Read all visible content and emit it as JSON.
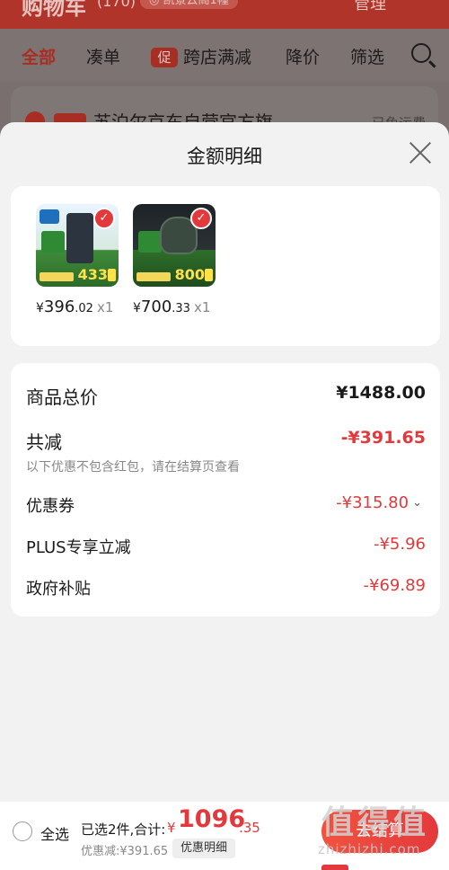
{
  "background": {
    "title": "购物车",
    "count": "(170)",
    "address": "凯景云阁1幢",
    "manage": "管理",
    "tabs": [
      {
        "label": "全部",
        "active": true
      },
      {
        "label": "凑单",
        "active": false
      },
      {
        "label": "跨店满减",
        "promo": "促",
        "active": false
      },
      {
        "label": "降价",
        "active": false
      },
      {
        "label": "筛选",
        "active": false
      }
    ],
    "store": {
      "tag": "自营",
      "name": "苏泊尔京东自营官方旗…",
      "shipping": "已免运费"
    }
  },
  "sheet": {
    "title": "金额明细",
    "products": [
      {
        "symbol": "¥",
        "int": "396",
        "dec": ".02",
        "qty": "x1",
        "thumb_price": "433",
        "icon": "water-dispenser-thumb"
      },
      {
        "symbol": "¥",
        "int": "700",
        "dec": ".33",
        "qty": "x1",
        "thumb_price": "800",
        "icon": "gaming-mouse-thumb"
      }
    ],
    "rows": {
      "total": {
        "label": "商品总价",
        "value": "¥1488.00"
      },
      "reduce": {
        "label": "共减",
        "value": "-¥391.65",
        "note": "以下优惠不包含红包，请在结算页查看"
      },
      "coupon": {
        "label": "优惠券",
        "value": "-¥315.80"
      },
      "plus": {
        "label": "PLUS专享立减",
        "value": "-¥5.96"
      },
      "gov": {
        "label": "政府补贴",
        "value": "-¥69.89"
      }
    }
  },
  "bottom": {
    "select_all": "全选",
    "summary": "已选2件,合计:",
    "total_symbol": "¥",
    "total_int": "1096",
    "total_dec": ".35",
    "saved": "优惠减:¥391.65",
    "detail_button": "优惠明细",
    "checkout": "去结算"
  },
  "watermark": {
    "big": "值得值",
    "small": "zhizhizhi.com"
  },
  "colors": {
    "accent": "#e4393c",
    "header_dim": "#b0342a"
  }
}
